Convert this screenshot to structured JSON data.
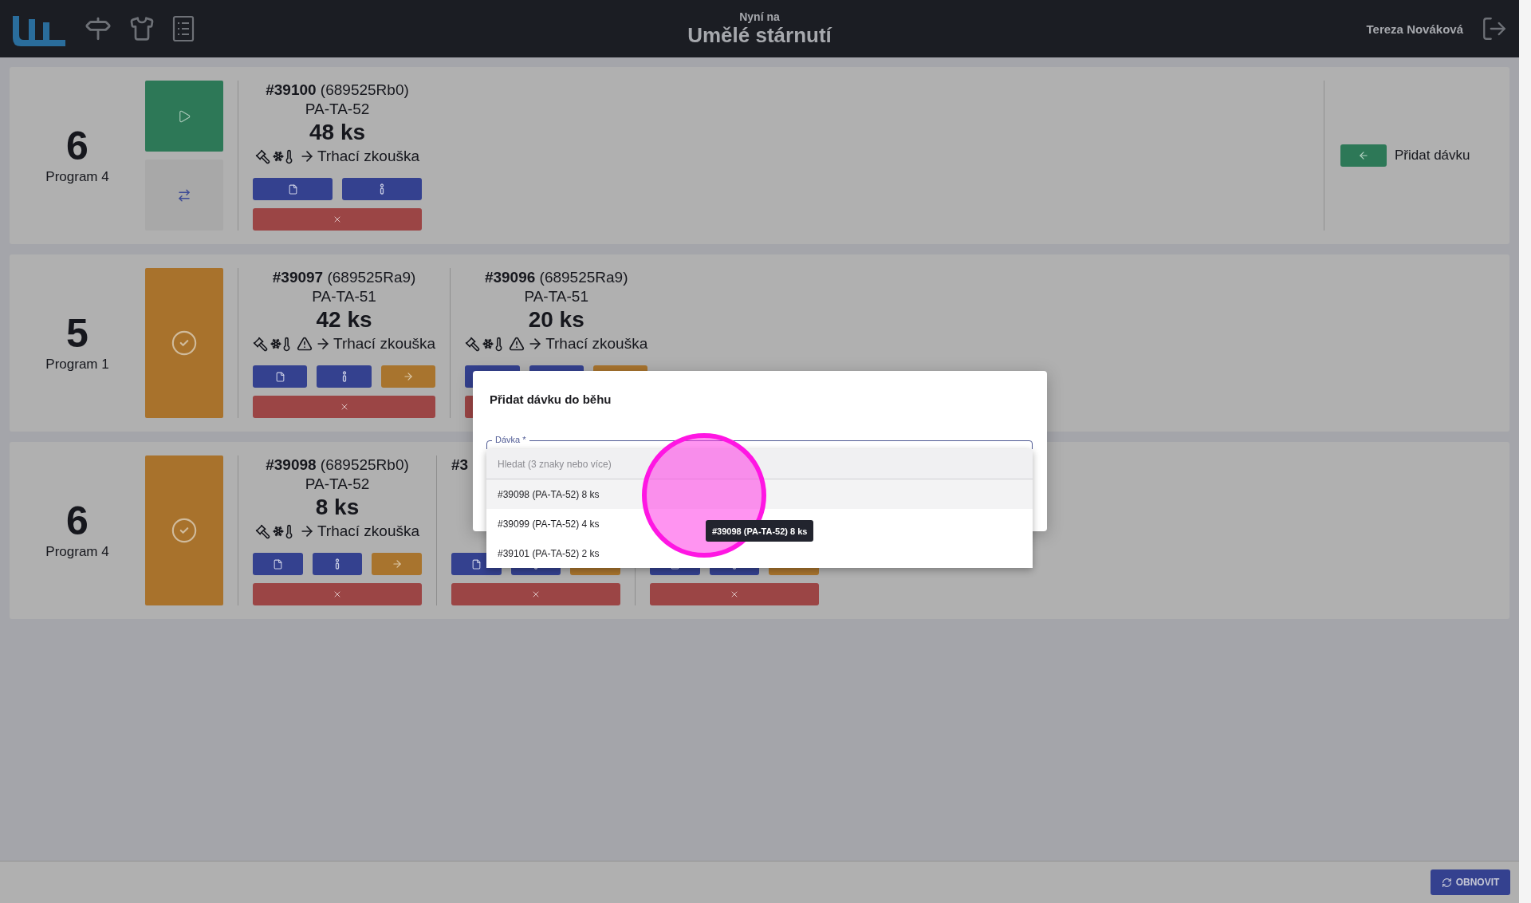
{
  "header": {
    "subtitle": "Nyní na",
    "title": "Umělé stárnutí",
    "user": "Tereza Nováková"
  },
  "rows": [
    {
      "number": "6",
      "program": "Program 4",
      "kind": "ready",
      "add_button": "Přidat dávku",
      "batches": [
        {
          "number": "#39100",
          "ref": "(689525Rb0)",
          "part": "PA-TA-52",
          "qty": "48 ks",
          "warning": false,
          "next": "Trhací zkouška",
          "advance": false
        }
      ]
    },
    {
      "number": "5",
      "program": "Program 1",
      "kind": "done",
      "batches": [
        {
          "number": "#39097",
          "ref": "(689525Ra9)",
          "part": "PA-TA-51",
          "qty": "42 ks",
          "warning": true,
          "next": "Trhací zkouška",
          "advance": true
        },
        {
          "number": "#39096",
          "ref": "(689525Ra9)",
          "part": "PA-TA-51",
          "qty": "20 ks",
          "warning": true,
          "next": "Trhací zkouška",
          "advance": true
        }
      ]
    },
    {
      "number": "6",
      "program": "Program 4",
      "kind": "done",
      "batches": [
        {
          "number": "#39098",
          "ref": "(689525Rb0)",
          "part": "PA-TA-52",
          "qty": "8 ks",
          "warning": false,
          "next": "Trhací zkouška",
          "advance": true
        },
        {
          "number": "#3",
          "advance": true
        },
        {
          "advance": true
        }
      ]
    }
  ],
  "dialog": {
    "title": "Přidat dávku do běhu",
    "field_label": "Dávka *",
    "search_placeholder": "Hledat (3 znaky nebo více)",
    "options": [
      {
        "label": "#39098 (PA-TA-52) 8 ks",
        "selected": true
      },
      {
        "label": "#39099 (PA-TA-52) 4 ks",
        "selected": false
      },
      {
        "label": "#39101 (PA-TA-52) 2 ks",
        "selected": false
      }
    ],
    "tooltip": "#39098 (PA-TA-52) 8 ks"
  },
  "refresh_button": "OBNOVIT"
}
